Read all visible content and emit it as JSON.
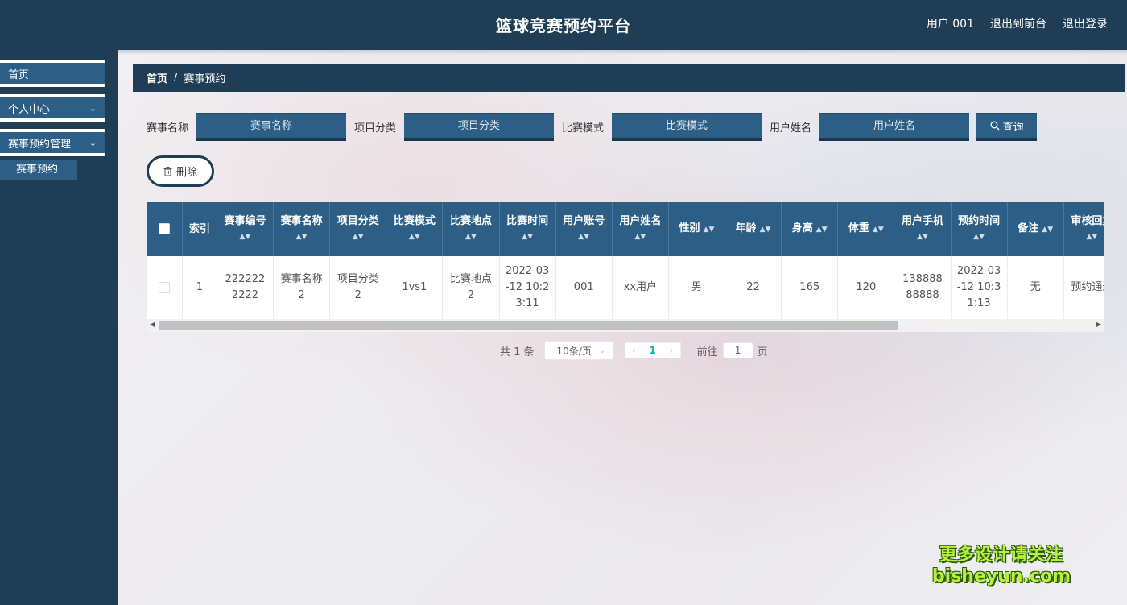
{
  "header": {
    "title": "篮球竞赛预约平台",
    "user": "用户 001",
    "exit_front": "退出到前台",
    "logout": "退出登录"
  },
  "sidebar": {
    "items": [
      {
        "label": "首页",
        "has_chevron": false
      },
      {
        "label": "个人中心",
        "has_chevron": true
      },
      {
        "label": "赛事预约管理",
        "has_chevron": true
      }
    ],
    "sub_item": "赛事预约"
  },
  "breadcrumb": {
    "home": "首页",
    "separator": "/",
    "current": "赛事预约"
  },
  "search": {
    "fields": [
      {
        "label": "赛事名称",
        "placeholder": "赛事名称"
      },
      {
        "label": "项目分类",
        "placeholder": "项目分类"
      },
      {
        "label": "比赛模式",
        "placeholder": "比赛模式"
      },
      {
        "label": "用户姓名",
        "placeholder": "用户姓名"
      }
    ],
    "query_label": "查询"
  },
  "actions": {
    "delete_label": "删除"
  },
  "table": {
    "headers": [
      {
        "label": "索引",
        "sortable": false
      },
      {
        "label": "赛事编号",
        "sortable": true
      },
      {
        "label": "赛事名称",
        "sortable": true
      },
      {
        "label": "项目分类",
        "sortable": true
      },
      {
        "label": "比赛模式",
        "sortable": true
      },
      {
        "label": "比赛地点",
        "sortable": true
      },
      {
        "label": "比赛时间",
        "sortable": true
      },
      {
        "label": "用户账号",
        "sortable": true
      },
      {
        "label": "用户姓名",
        "sortable": true
      },
      {
        "label": "性别",
        "sortable": true
      },
      {
        "label": "年龄",
        "sortable": true
      },
      {
        "label": "身高",
        "sortable": true
      },
      {
        "label": "体重",
        "sortable": true
      },
      {
        "label": "用户手机",
        "sortable": true
      },
      {
        "label": "预约时间",
        "sortable": true
      },
      {
        "label": "备注",
        "sortable": true
      },
      {
        "label": "审核回复",
        "sortable": true
      }
    ],
    "rows": [
      [
        "1",
        "2222222222",
        "赛事名称2",
        "项目分类2",
        "1vs1",
        "比赛地点2",
        "2022-03-12 10:23:11",
        "001",
        "xx用户",
        "男",
        "22",
        "165",
        "120",
        "13888888888",
        "2022-03-12 10:31:13",
        "无",
        "预约通过"
      ]
    ]
  },
  "pagination": {
    "total": "共 1 条",
    "page_size": "10条/页",
    "current_page": "1",
    "goto_label": "前往",
    "goto_value": "1",
    "page_suffix": "页"
  },
  "watermark": {
    "line1": "更多设计请关注",
    "line2": "bisheyun.com"
  },
  "colors": {
    "header_bg": "#1f3d55",
    "accent": "#2d5f86",
    "active_page": "#17b3a3"
  }
}
